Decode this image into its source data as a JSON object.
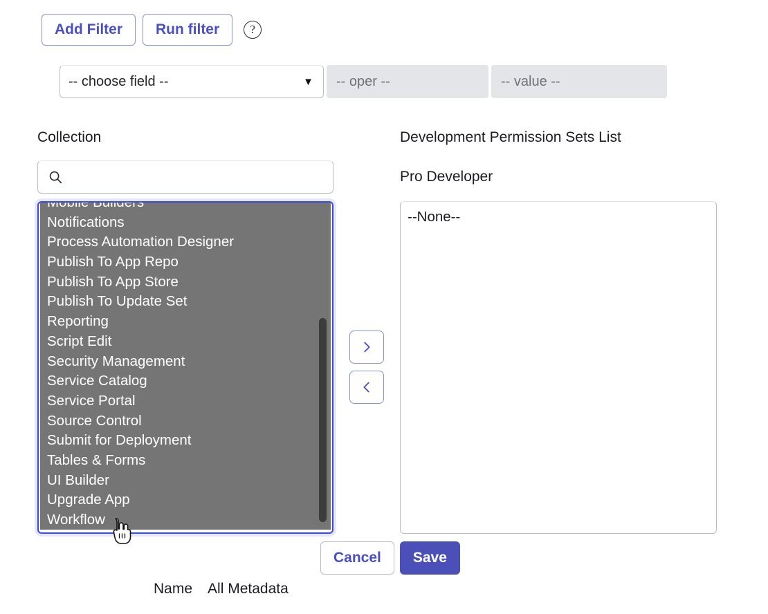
{
  "toolbar": {
    "add_filter_label": "Add Filter",
    "run_filter_label": "Run filter",
    "help_icon_glyph": "?",
    "help_icon_name": "question-circle-icon"
  },
  "filter_row": {
    "field_value": "-- choose field --",
    "field_caret_glyph": "▼",
    "oper_value": "-- oper --",
    "value_value": "-- value --"
  },
  "collection_panel": {
    "label": "Collection",
    "search_placeholder": "",
    "search_value": "",
    "search_icon_name": "search-icon",
    "scroll_position": "lower",
    "options": [
      "Mobile Builders",
      "Notifications",
      "Process Automation Designer",
      "Publish To App Repo",
      "Publish To App Store",
      "Publish To Update Set",
      "Reporting",
      "Script Edit",
      "Security Management",
      "Service Catalog",
      "Service Portal",
      "Source Control",
      "Submit for Deployment",
      "Tables & Forms",
      "UI Builder",
      "Upgrade App",
      "Workflow"
    ]
  },
  "transfer": {
    "move_right_glyph": "›",
    "move_left_glyph": "‹"
  },
  "target_panel": {
    "title": "Development Permission Sets List",
    "subtitle": "Pro Developer",
    "options": [
      "--None--"
    ]
  },
  "footer": {
    "cancel_label": "Cancel",
    "save_label": "Save"
  },
  "meta_row": {
    "name_label": "Name",
    "all_metadata_label": "All Metadata"
  },
  "colors": {
    "accent": "#4b50b8",
    "accent_link": "#4b4fc4",
    "focus_ring": "#3b49df",
    "list_selected_bg": "#757575",
    "disabled_field_bg": "#e4e5e9",
    "page_bg": "#ffffff"
  }
}
